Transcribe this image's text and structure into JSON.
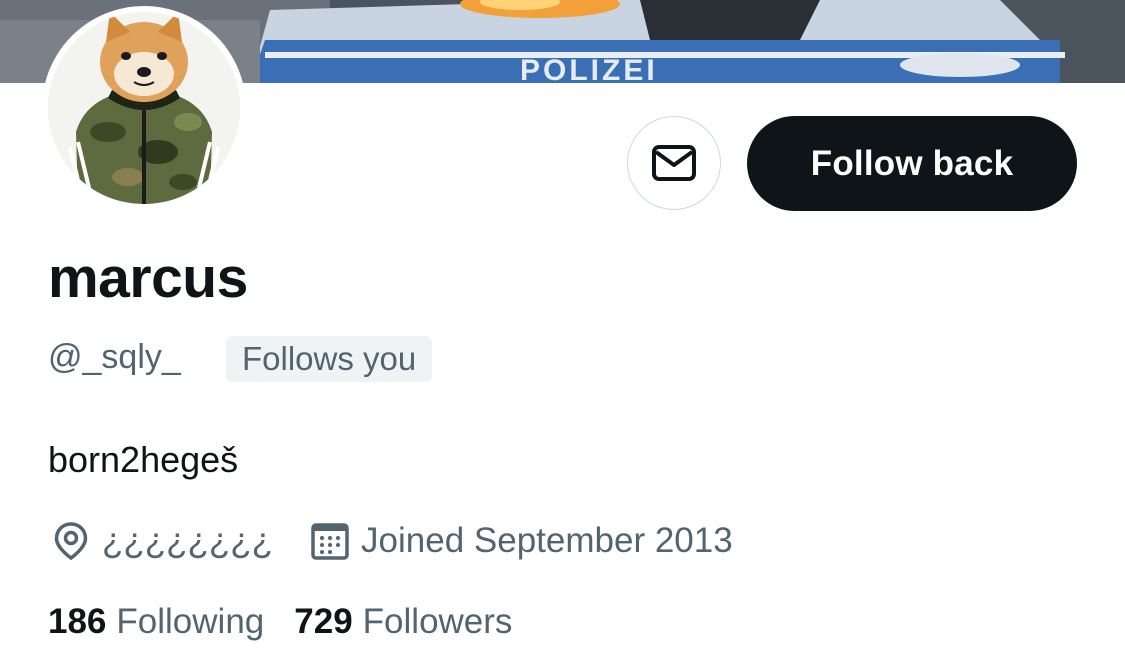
{
  "profile": {
    "display_name": "marcus",
    "handle": "@_sqly_",
    "follows_you_badge": "Follows you",
    "bio": "born2hegeš",
    "location": "¿¿¿¿¿¿¿¿",
    "joined": "Joined September 2013",
    "banner_text": "POLIZEI"
  },
  "actions": {
    "message_icon": "envelope-icon",
    "follow_label": "Follow back"
  },
  "stats": {
    "following_count": "186",
    "following_label": "Following",
    "followers_count": "729",
    "followers_label": "Followers"
  },
  "icons": {
    "location": "location-pin-icon",
    "calendar": "calendar-icon"
  },
  "colors": {
    "text_primary": "#0f1419",
    "text_secondary": "#536471",
    "button_dark": "#0f1419",
    "badge_bg": "#eff3f4",
    "border": "#cfd9de"
  }
}
